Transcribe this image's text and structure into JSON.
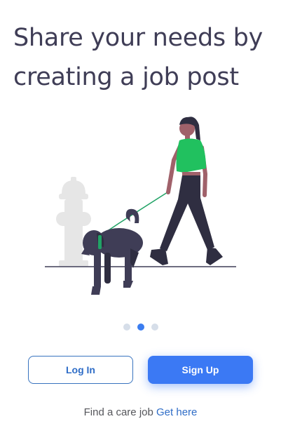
{
  "onboarding": {
    "headline": "Share your needs by creating a job post",
    "illustration_icon": "woman-walking-dog-illustration",
    "pagination": {
      "total": 3,
      "active_index": 1,
      "active_color": "#3b7df0",
      "inactive_color": "#d6dee9"
    }
  },
  "actions": {
    "login_label": "Log In",
    "signup_label": "Sign Up",
    "primary_color": "#3b79f4"
  },
  "footer": {
    "prompt": "Find a care job",
    "link_label": "Get here"
  }
}
